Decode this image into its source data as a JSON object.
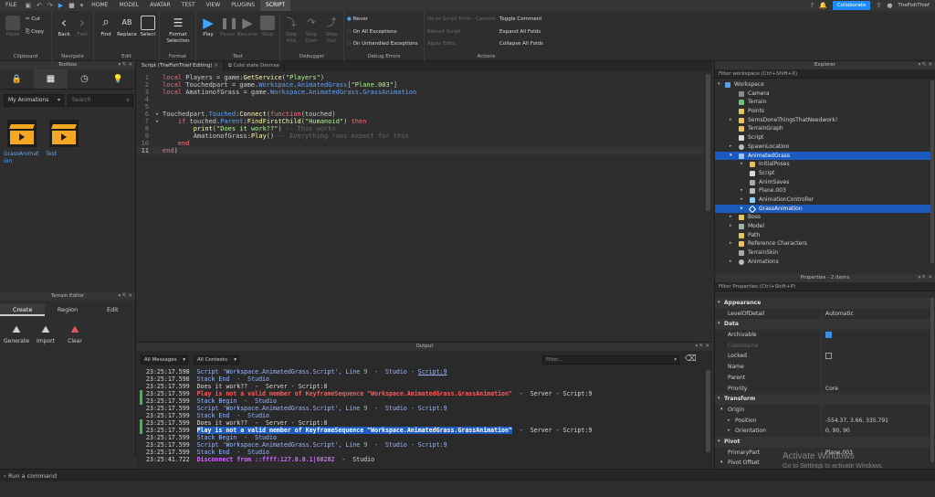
{
  "menubar": {
    "items": [
      "FILE",
      "HOME",
      "MODEL",
      "AVATAR",
      "TEST",
      "VIEW",
      "PLUGINS",
      "SCRIPT"
    ],
    "collaborate": "Collaborate",
    "user": "TheFishThief"
  },
  "ribbon": {
    "clipboard": {
      "title": "Clipboard",
      "paste": "Paste",
      "cut": "Cut",
      "copy": "Copy"
    },
    "navigate": {
      "title": "Navigate",
      "back": "Back",
      "fwd": "Fwd"
    },
    "edit": {
      "title": "Edit",
      "find": "Find",
      "replace": "Replace",
      "select": "Select"
    },
    "format": {
      "title": "Format",
      "format_selection": "Format Selection"
    },
    "test": {
      "title": "Test",
      "play": "Play",
      "pause": "Pause",
      "resume": "Resume",
      "stop": "Stop"
    },
    "debugger": {
      "title": "Debugger",
      "step_into": "Step Into",
      "step_over": "Step Over",
      "step_out": "Step Out"
    },
    "debug_errors": {
      "title": "Debug Errors",
      "never": "Never",
      "all_exceptions": "On All Exceptions",
      "unhandled": "On Unhandled Exceptions"
    },
    "actions": {
      "title": "Actions",
      "goto_error": "Go to Script Error",
      "commit": "Commit",
      "reload": "Reload Script",
      "apply": "Apply Edits",
      "toggle_comment": "Toggle Comment",
      "expand": "Expand All Folds",
      "collapse": "Collapse All Folds"
    }
  },
  "toolbox": {
    "title": "Toolbox",
    "dropdown": "My Animations",
    "search_placeholder": "Search",
    "items": [
      {
        "label": "GrassAnimation"
      },
      {
        "label": "Test"
      }
    ]
  },
  "terrain": {
    "title": "Terrain Editor",
    "tabs": [
      "Create",
      "Region",
      "Edit"
    ],
    "tools": [
      "Generate",
      "Import",
      "Clear"
    ]
  },
  "editor": {
    "tabs": [
      "Script (TheFishThief Editing)",
      "Cold state Demise"
    ],
    "line_numbers": [
      "1",
      "2",
      "3",
      "4",
      "5",
      "6",
      "7",
      "8",
      "9",
      "10",
      "11"
    ]
  },
  "output": {
    "title": "Output",
    "filter_messages": "All Messages",
    "filter_contexts": "All Contexts",
    "filter_placeholder": "Filter..."
  },
  "explorer": {
    "title": "Explorer",
    "filter": "Filter workspace (Ctrl+Shift+X)",
    "items": [
      "Workspace",
      "Camera",
      "Terrain",
      "Points",
      "SemsDoneThingsThatNeedwork!",
      "TerrainGraph",
      "Script",
      "SpawnLocation",
      "AnimatedGrass",
      "InitialPoses",
      "Script",
      "AnimSaves",
      "Plane.003",
      "AnimationController",
      "GrassAnimation",
      "Boss",
      "Model",
      "Path",
      "Reference Characters",
      "TerrainSkin",
      "Animations"
    ]
  },
  "properties": {
    "title": "Properties - 2 items",
    "filter": "Filter Properties (Ctrl+Shift+P)",
    "rows": [
      {
        "k": "Appearance",
        "h": true
      },
      {
        "k": "LevelOfDetail",
        "v": "Automatic"
      },
      {
        "k": "Data",
        "h": true
      },
      {
        "k": "Archivable",
        "chk": true
      },
      {
        "k": "ClassName",
        "dim": true
      },
      {
        "k": "Locked",
        "chk": false
      },
      {
        "k": "Name"
      },
      {
        "k": "Parent"
      },
      {
        "k": "Priority",
        "v": "Core"
      },
      {
        "k": "Transform",
        "h": true
      },
      {
        "k": "Origin",
        "sub": true
      },
      {
        "k": "Position",
        "v": "-554.37, 3.66, 335.791",
        "ind": true
      },
      {
        "k": "Orientation",
        "v": "0, 90, 90",
        "ind": true
      },
      {
        "k": "Pivot",
        "h": true
      },
      {
        "k": "PrimaryPart",
        "v": "Plane.003"
      },
      {
        "k": "Pivot Offset",
        "sub": true
      }
    ]
  },
  "watermark": {
    "title": "Activate Windows",
    "sub": "Go to Settings to activate Windows."
  },
  "command_bar": {
    "placeholder": "Run a command"
  }
}
